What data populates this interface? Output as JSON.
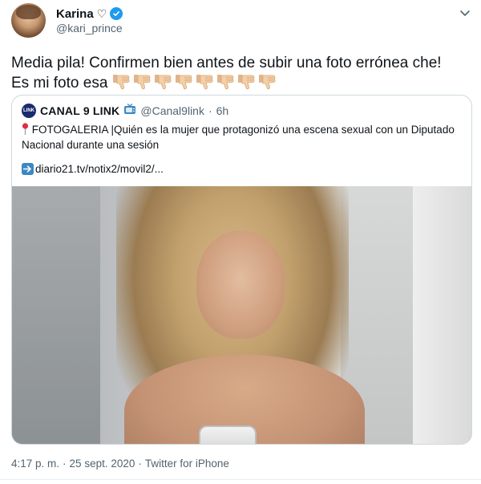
{
  "author": {
    "display_name": "Karina",
    "name_suffix": "♡",
    "handle": "@kari_prince",
    "verified": true,
    "verified_color": "#1d9bf0"
  },
  "tweet": {
    "text_line1": "Media pila! Confirmen bien antes de subir una foto errónea che!",
    "text_line2": "Es mi foto esa",
    "emoji": "thumbs-down-emoji",
    "emoji_count": 8
  },
  "quoted": {
    "name": "CANAL 9 LINK",
    "name_emoji": "television-icon",
    "handle": "@Canal9link",
    "separator": "·",
    "time": "6h",
    "avatar_text": "LINK",
    "text": "FOTOGALERIA |Quién es la mujer que protagonizó una escena sexual con un Diputado Nacional durante una sesión",
    "pin_emoji": "round-pushpin-icon",
    "link_emoji": "right-arrow-icon",
    "link": "diario21.tv/notix2/movil2/..."
  },
  "footer": {
    "time": "4:17 p. m.",
    "sep1": "·",
    "date": "25 sept. 2020",
    "sep2": "·",
    "source": "Twitter for iPhone"
  },
  "colors": {
    "text": "#0f1419",
    "secondary": "#536471",
    "border": "#cfd9de",
    "link_arrow": "#3b88c3"
  }
}
